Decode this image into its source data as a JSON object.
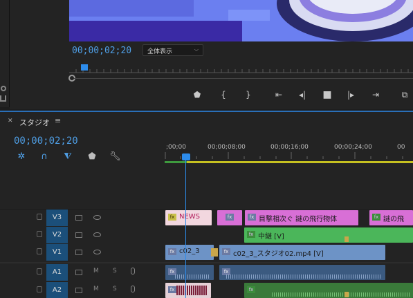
{
  "monitor": {
    "timecode": "00;00;02;20",
    "fit_value": "全体表示"
  },
  "timeline": {
    "tab_title": "スタジオ",
    "timecode": "00;00;02;20",
    "ruler_labels": [
      ";00;00",
      "00;00;08;00",
      "00;00;16;00",
      "00;00;24;00",
      "00"
    ],
    "tracks": {
      "v3": "V3",
      "v2": "V2",
      "v1": "V1",
      "a1": "A1",
      "a2": "A2"
    },
    "mute_label": "M",
    "solo_label": "S",
    "clips": {
      "news": "NEWS",
      "headline1": "目撃相次ぐ 謎の飛行物体",
      "headline2": "謎の飛",
      "relay": "中継 [V]",
      "c02_short": "c02_3",
      "c02_long": "c02_3_スタジオ02.mp4 [V]"
    }
  },
  "colors": {
    "accent": "#2d8ceb",
    "timecode": "#4f9fe6",
    "clip_pink": "#d86fd6",
    "clip_green": "#4bb65a",
    "clip_blue": "#6d93c6"
  },
  "icons": {
    "snap": "snap-icon",
    "linked": "linked-selection-icon",
    "add_marker": "add-marker-icon",
    "settings": "wrench-icon"
  }
}
